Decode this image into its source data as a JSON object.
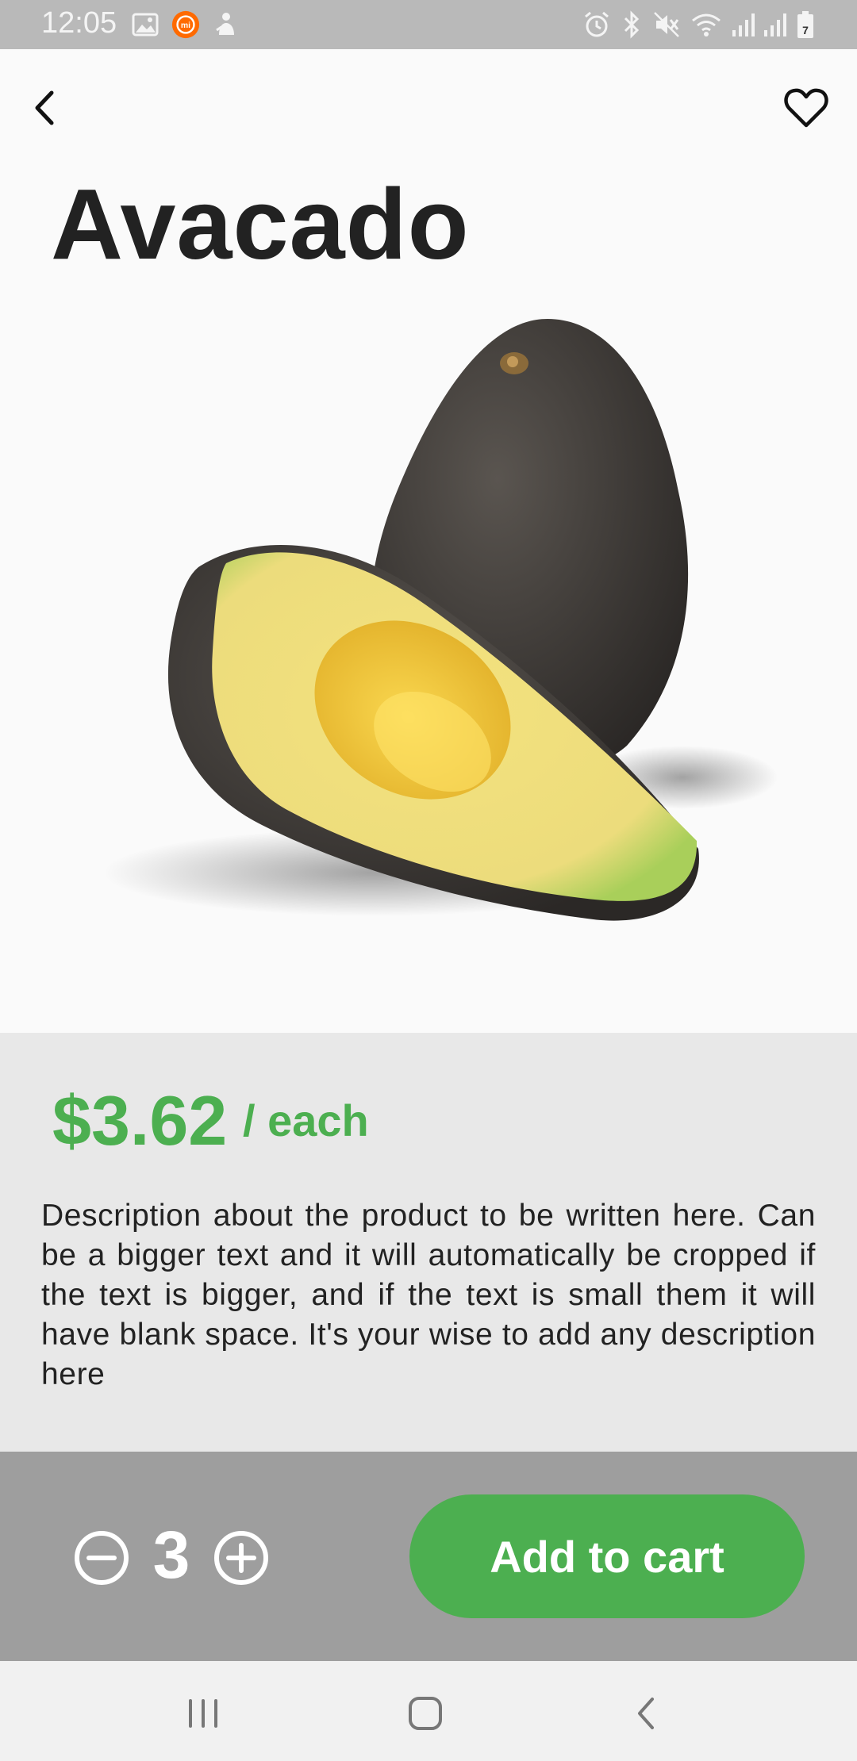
{
  "status_bar": {
    "time": "12:05",
    "left_icons": [
      "gallery-icon",
      "mi-icon",
      "notification-icon"
    ],
    "right_icons": [
      "alarm-icon",
      "bluetooth-icon",
      "mute-icon",
      "wifi-icon",
      "signal-icon",
      "signal-icon",
      "battery-icon"
    ],
    "mi_badge": "mi",
    "battery_level": "7"
  },
  "header": {
    "back_icon": "chevron-left-icon",
    "favorite_icon": "heart-outline-icon"
  },
  "product": {
    "name": "Avacado",
    "image": "avocado-image",
    "price": "$3.62",
    "unit": "/ each",
    "description": "Description about the product to be written here. Can be a bigger text and it will automatically be cropped if the text is bigger, and if the text is small them it will have blank space. It's your wise to add any description here"
  },
  "cart": {
    "quantity": "3",
    "decrement_icon": "minus-circle-icon",
    "increment_icon": "plus-circle-icon",
    "add_label": "Add to cart"
  },
  "nav_bar": {
    "icons": [
      "recent-apps-icon",
      "home-icon",
      "back-icon"
    ]
  },
  "colors": {
    "accent": "#4caf50",
    "status_bar": "#b9b9b9",
    "info_panel": "#e8e8e8",
    "bottom_panel": "#9e9e9e",
    "title_text": "#222222"
  }
}
